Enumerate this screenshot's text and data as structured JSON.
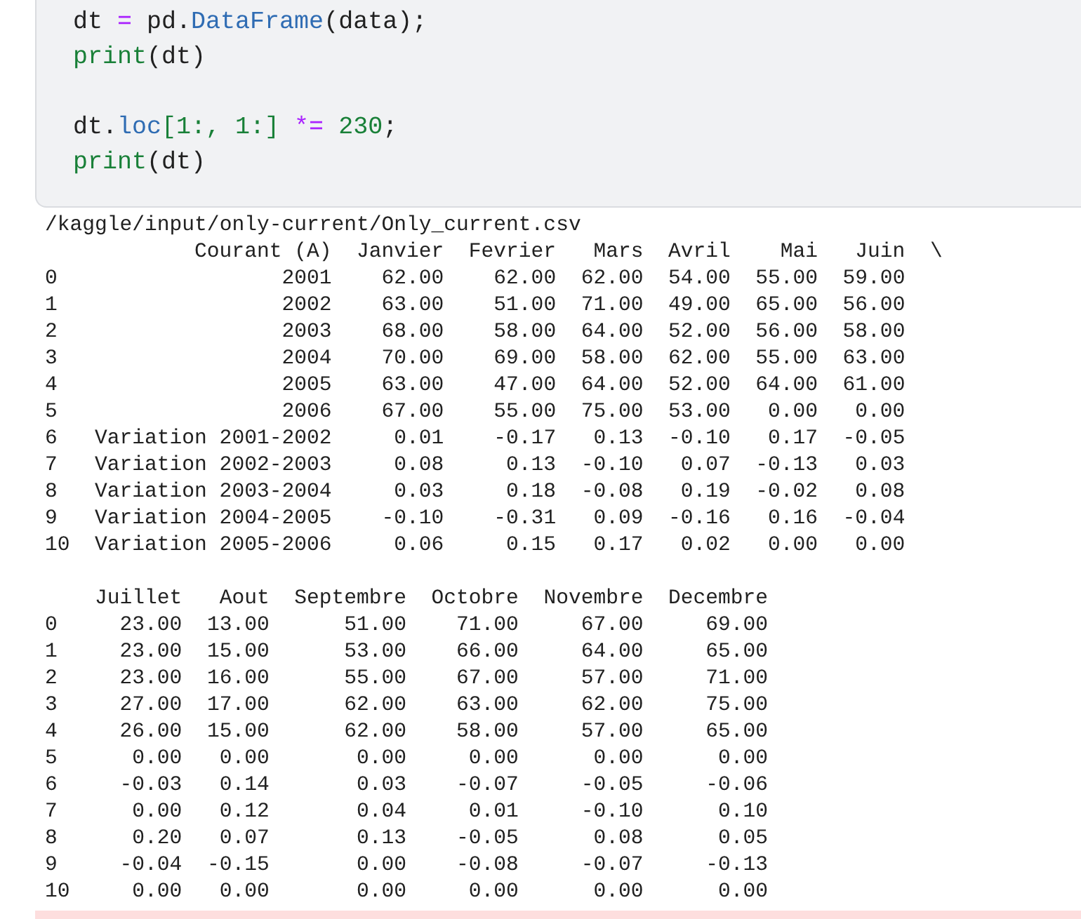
{
  "code_cell": {
    "lines": [
      {
        "kind": "code",
        "tokens": [
          {
            "text": "dt ",
            "kind": "plain"
          },
          {
            "text": "=",
            "kind": "operator"
          },
          {
            "text": " pd.",
            "kind": "plain"
          },
          {
            "text": "DataFrame",
            "kind": "name"
          },
          {
            "text": "(data);",
            "kind": "plain"
          }
        ]
      },
      {
        "kind": "code",
        "tokens": [
          {
            "text": "print",
            "kind": "builtin"
          },
          {
            "text": "(dt)",
            "kind": "plain"
          }
        ]
      },
      {
        "kind": "blank"
      },
      {
        "kind": "code",
        "tokens": [
          {
            "text": "dt.",
            "kind": "plain"
          },
          {
            "text": "loc",
            "kind": "name"
          },
          {
            "text": "[1:, 1:]",
            "kind": "number"
          },
          {
            "text": " *=",
            "kind": "operator"
          },
          {
            "text": " 230",
            "kind": "number"
          },
          {
            "text": ";",
            "kind": "plain"
          }
        ]
      },
      {
        "kind": "code",
        "tokens": [
          {
            "text": "print",
            "kind": "builtin"
          },
          {
            "text": "(dt)",
            "kind": "plain"
          }
        ]
      }
    ]
  },
  "output": {
    "path": "/kaggle/input/only-current/Only_current.csv",
    "frames": [
      {
        "columns": [
          "Courant (A)",
          "Janvier",
          "Fevrier",
          "Mars",
          "Avril",
          "Mai",
          "Juin"
        ],
        "continuation": "\\",
        "rows": [
          {
            "index": "0",
            "cells": [
              "2001",
              "62.00",
              "62.00",
              "62.00",
              "54.00",
              "55.00",
              "59.00"
            ]
          },
          {
            "index": "1",
            "cells": [
              "2002",
              "63.00",
              "51.00",
              "71.00",
              "49.00",
              "65.00",
              "56.00"
            ]
          },
          {
            "index": "2",
            "cells": [
              "2003",
              "68.00",
              "58.00",
              "64.00",
              "52.00",
              "56.00",
              "58.00"
            ]
          },
          {
            "index": "3",
            "cells": [
              "2004",
              "70.00",
              "69.00",
              "58.00",
              "62.00",
              "55.00",
              "63.00"
            ]
          },
          {
            "index": "4",
            "cells": [
              "2005",
              "63.00",
              "47.00",
              "64.00",
              "52.00",
              "64.00",
              "61.00"
            ]
          },
          {
            "index": "5",
            "cells": [
              "2006",
              "67.00",
              "55.00",
              "75.00",
              "53.00",
              "0.00",
              "0.00"
            ]
          },
          {
            "index": "6",
            "cells": [
              "Variation 2001-2002",
              "0.01",
              "-0.17",
              "0.13",
              "-0.10",
              "0.17",
              "-0.05"
            ]
          },
          {
            "index": "7",
            "cells": [
              "Variation 2002-2003",
              "0.08",
              "0.13",
              "-0.10",
              "0.07",
              "-0.13",
              "0.03"
            ]
          },
          {
            "index": "8",
            "cells": [
              "Variation 2003-2004",
              "0.03",
              "0.18",
              "-0.08",
              "0.19",
              "-0.02",
              "0.08"
            ]
          },
          {
            "index": "9",
            "cells": [
              "Variation 2004-2005",
              "-0.10",
              "-0.31",
              "0.09",
              "-0.16",
              "0.16",
              "-0.04"
            ]
          },
          {
            "index": "10",
            "cells": [
              "Variation 2005-2006",
              "0.06",
              "0.15",
              "0.17",
              "0.02",
              "0.00",
              "0.00"
            ]
          }
        ]
      },
      {
        "columns": [
          "Juillet",
          "Aout",
          "Septembre",
          "Octobre",
          "Novembre",
          "Decembre"
        ],
        "rows": [
          {
            "index": "0",
            "cells": [
              "23.00",
              "13.00",
              "51.00",
              "71.00",
              "67.00",
              "69.00"
            ]
          },
          {
            "index": "1",
            "cells": [
              "23.00",
              "15.00",
              "53.00",
              "66.00",
              "64.00",
              "65.00"
            ]
          },
          {
            "index": "2",
            "cells": [
              "23.00",
              "16.00",
              "55.00",
              "67.00",
              "57.00",
              "71.00"
            ]
          },
          {
            "index": "3",
            "cells": [
              "27.00",
              "17.00",
              "62.00",
              "63.00",
              "62.00",
              "75.00"
            ]
          },
          {
            "index": "4",
            "cells": [
              "26.00",
              "15.00",
              "62.00",
              "58.00",
              "57.00",
              "65.00"
            ]
          },
          {
            "index": "5",
            "cells": [
              "0.00",
              "0.00",
              "0.00",
              "0.00",
              "0.00",
              "0.00"
            ]
          },
          {
            "index": "6",
            "cells": [
              "-0.03",
              "0.14",
              "0.03",
              "-0.07",
              "-0.05",
              "-0.06"
            ]
          },
          {
            "index": "7",
            "cells": [
              "0.00",
              "0.12",
              "0.04",
              "0.01",
              "-0.10",
              "0.10"
            ]
          },
          {
            "index": "8",
            "cells": [
              "0.20",
              "0.07",
              "0.13",
              "-0.05",
              "0.08",
              "0.05"
            ]
          },
          {
            "index": "9",
            "cells": [
              "-0.04",
              "-0.15",
              "0.00",
              "-0.08",
              "-0.07",
              "-0.13"
            ]
          },
          {
            "index": "10",
            "cells": [
              "0.00",
              "0.00",
              "0.00",
              "0.00",
              "0.00",
              "0.00"
            ]
          }
        ]
      }
    ]
  }
}
